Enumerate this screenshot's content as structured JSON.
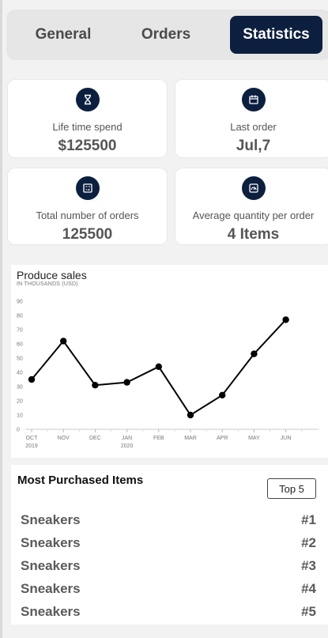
{
  "tabs": [
    {
      "label": "General",
      "active": false
    },
    {
      "label": "Orders",
      "active": false
    },
    {
      "label": "Statistics",
      "active": true
    }
  ],
  "stats": [
    {
      "label": "Life time spend",
      "value": "$125500",
      "icon": "hourglass-icon"
    },
    {
      "label": "Last order",
      "value": "Jul,7",
      "icon": "calendar-icon"
    },
    {
      "label": "Total number of orders",
      "value": "125500",
      "icon": "calculator-icon"
    },
    {
      "label": "Average quantity per order",
      "value": "4 Items",
      "icon": "gauge-icon"
    }
  ],
  "chart_data": {
    "type": "line",
    "title": "Produce sales",
    "subtitle": "IN THOUSANDS (USD)",
    "categories": [
      "OCT",
      "NOV",
      "DEC",
      "JAN",
      "FEB",
      "MAR",
      "APR",
      "MAY",
      "JUN"
    ],
    "category_sublabels": [
      "2019",
      "",
      "",
      "2020",
      "",
      "",
      "",
      "",
      ""
    ],
    "values": [
      35,
      62,
      31,
      33,
      44,
      10,
      24,
      53,
      77
    ],
    "ylim": [
      0,
      90
    ],
    "yticks": [
      0,
      10,
      20,
      30,
      40,
      50,
      60,
      70,
      80,
      90
    ],
    "grid": false,
    "line_color": "#000000"
  },
  "most_purchased": {
    "title": "Most Purchased Items",
    "filter_label": "Top 5",
    "items": [
      {
        "name": "Sneakers",
        "rank": "#1"
      },
      {
        "name": "Sneakers",
        "rank": "#2"
      },
      {
        "name": "Sneakers",
        "rank": "#3"
      },
      {
        "name": "Sneakers",
        "rank": "#4"
      },
      {
        "name": "Sneakers",
        "rank": "#5"
      }
    ]
  },
  "colors": {
    "accent": "#0c1f3f",
    "background": "#f2f2f2"
  }
}
